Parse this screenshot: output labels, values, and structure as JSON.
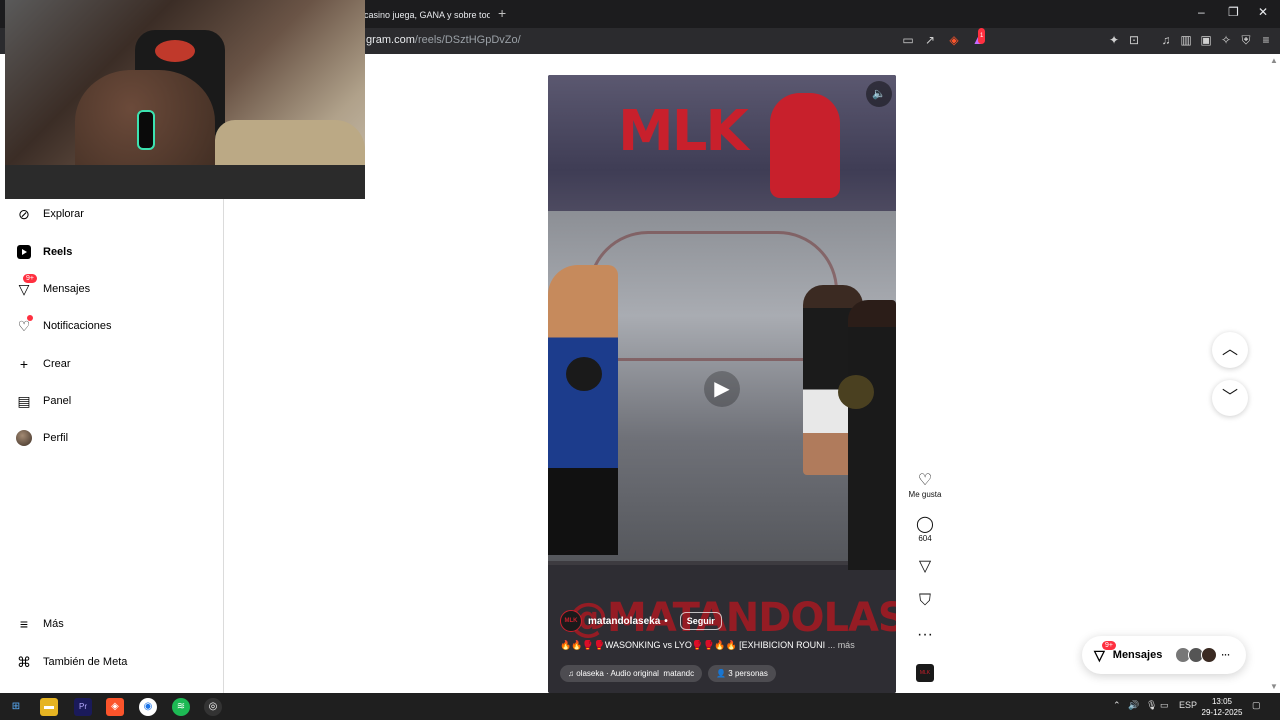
{
  "browser": {
    "tab_title": "casino juega, GANA y sobre todo",
    "tab_add": "+",
    "url_host": "gram.com",
    "url_path": "/reels/DSztHGpDvZo/",
    "brave_badge": "1",
    "window_controls": [
      "–",
      "❐",
      "✕"
    ]
  },
  "sidebar": {
    "items": [
      {
        "label": "Explorar",
        "icon": "compass-icon"
      },
      {
        "label": "Reels",
        "icon": "reels-icon"
      },
      {
        "label": "Mensajes",
        "icon": "messenger-icon",
        "badge": "9+"
      },
      {
        "label": "Notificaciones",
        "icon": "heart-icon"
      },
      {
        "label": "Crear",
        "icon": "plus-icon"
      },
      {
        "label": "Panel",
        "icon": "chart-icon"
      },
      {
        "label": "Perfil",
        "icon": "avatar"
      }
    ],
    "bottom": [
      {
        "label": "Más",
        "icon": "menu-icon"
      },
      {
        "label": "También de Meta",
        "icon": "meta-icon"
      }
    ]
  },
  "reel": {
    "banner_text": "MLK",
    "watermark": "@MATANDOLASEKA",
    "avatar_text": "MLK",
    "username": "matandolaseka",
    "separator": "•",
    "follow": "Seguir",
    "caption": "🔥🔥🥊🥊WASONKING vs LYO🥊🥊🔥🔥 [EXHIBICION ROUNI",
    "caption_more": "... más",
    "audio": "♫ olaseka · Audio original",
    "audio_user": "matandc",
    "people": "👤 3 personas"
  },
  "actions": {
    "like_label": "Me gusta",
    "comments_count": "604"
  },
  "messages_pill": {
    "label": "Mensajes",
    "badge": "9+",
    "more": "···"
  },
  "taskbar": {
    "language": "ESP",
    "time": "13:05",
    "date": "29-12-2025"
  }
}
